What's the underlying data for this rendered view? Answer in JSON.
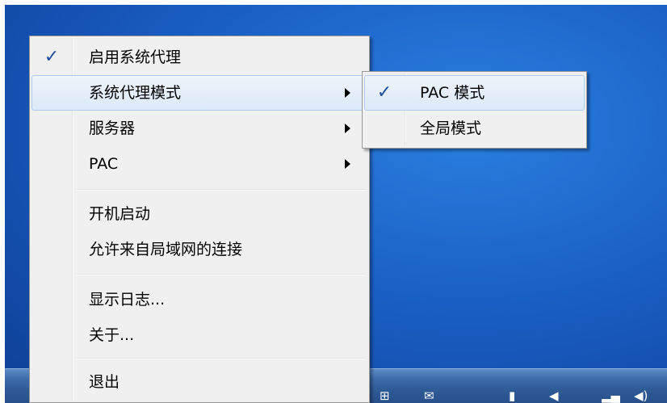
{
  "main_menu": {
    "items": [
      {
        "label": "启用系统代理",
        "checked_glyph": "✓"
      },
      {
        "label": "系统代理模式"
      },
      {
        "label": "服务器"
      },
      {
        "label": "PAC"
      },
      {
        "label": "开机启动"
      },
      {
        "label": "允许来自局域网的连接"
      },
      {
        "label": "显示日志..."
      },
      {
        "label": "关于..."
      },
      {
        "label": "退出"
      }
    ]
  },
  "sub_menu": {
    "items": [
      {
        "label": "PAC 模式",
        "checked_glyph": "✓"
      },
      {
        "label": "全局模式"
      }
    ]
  },
  "colors": {
    "desktop": "#1a5fc4",
    "menu_background": "#f0f0f0",
    "highlight": "#dce9f8",
    "check": "#1e4f9c"
  },
  "tray_icons": [
    "network-icon",
    "mail-icon",
    "usb-icon",
    "volume-mute-icon",
    "signal-icon",
    "speaker-icon"
  ]
}
